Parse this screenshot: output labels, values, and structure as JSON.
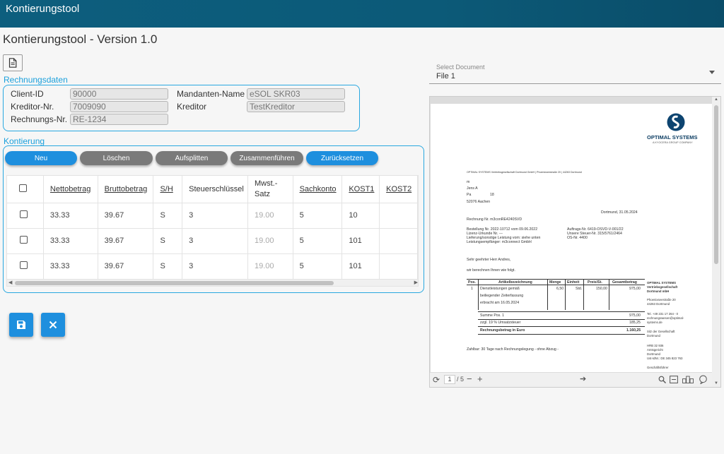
{
  "app": {
    "title": "Kontierungstool",
    "heading": "Kontierungstool - Version 1.0"
  },
  "rechnungsdaten": {
    "legend": "Rechnungsdaten",
    "client_id_label": "Client-ID",
    "client_id": "90000",
    "kreditor_nr_label": "Kreditor-Nr.",
    "kreditor_nr": "7009090",
    "rechnungs_nr_label": "Rechnungs-Nr.",
    "rechnungs_nr": "RE-1234",
    "mandant_label": "Mandanten-Name",
    "mandant": "eSOL SKR03",
    "kreditor_label": "Kreditor",
    "kreditor": "TestKreditor"
  },
  "kontierung": {
    "legend": "Kontierung",
    "buttons": {
      "neu": "Neu",
      "loeschen": "Löschen",
      "aufsplitten": "Aufsplitten",
      "zusammen": "Zusammenführen",
      "reset": "Zurücksetzen"
    },
    "columns": [
      "Nettobetrag",
      "Bruttobetrag",
      "S/H",
      "Steuerschlüssel",
      "Mwst.-Satz",
      "Sachkonto",
      "KOST1",
      "KOST2"
    ],
    "rows": [
      {
        "netto": "33.33",
        "brutto": "39.67",
        "sh": "S",
        "steuer": "3",
        "mwst": "19.00",
        "sachkonto": "5",
        "kost1": "10",
        "kost2": ""
      },
      {
        "netto": "33.33",
        "brutto": "39.67",
        "sh": "S",
        "steuer": "3",
        "mwst": "19.00",
        "sachkonto": "5",
        "kost1": "101",
        "kost2": ""
      },
      {
        "netto": "33.33",
        "brutto": "39.67",
        "sh": "S",
        "steuer": "3",
        "mwst": "19.00",
        "sachkonto": "5",
        "kost1": "101",
        "kost2": ""
      }
    ]
  },
  "actions": {
    "save_icon": "save-icon",
    "cancel_icon": "close-icon"
  },
  "document_select": {
    "label": "Select Document",
    "value": "File 1"
  },
  "viewer": {
    "page_current": "1",
    "page_total": "/ 5",
    "doc": {
      "brand": "OPTIMAL SYSTEMS",
      "brand_sub": "A KYOCERA GROUP COMPANY",
      "sender_line": "OPTIMAL SYSTEMS Vertriebsgesellschaft Dortmund GmbH | Phoenixseestraße 20 | 44263 Dortmund",
      "addr1": "m",
      "addr2": "Jens A",
      "addr3": "Pa",
      "addr3b": "18",
      "addr4": "52076 Aachen",
      "date": "Dortmund, 31.05.2024",
      "invoice_no": "Rechnung Nr. m3conRE4240SVD",
      "order1": "Bestellung Nr. 2022-10712 vom 09.06.2022",
      "order2": "Lizenz-Urkunde Nr. ---",
      "order3": "Lieferung/sonstige Leistung vom: siehe unten",
      "order4": "Leistungsempfänger: m3connect GmbH",
      "right1": "Auftrags-Nr. 6419-OSVD-V-001/22",
      "right2": "Unsere Steuer-Nr. 315/5761/2464",
      "right3": "OS-Nr.       4400",
      "greeting": "Sehr geehrter Herr Andres,",
      "intro": "wir berechnen Ihnen wie folgt.",
      "col_pos": "Pos.",
      "col_art": "Artikelbezeichnung",
      "col_menge": "Menge",
      "col_einheit": "Einheit",
      "col_preis": "Preis/St.",
      "col_gesamt": "Gesamtbetrag",
      "row_pos": "1",
      "row_art1": "Dienstleistungen gemäß",
      "row_art2": "beiliegender Zeiterfassung",
      "row_art3": "erbracht am 16.05.2024",
      "row_menge": "6,50",
      "row_einheit": "Std.",
      "row_preis": "150,00",
      "row_gesamt": "975,00",
      "sum1_label": "Summe Pos. 1",
      "sum1": "975,00",
      "tax_label": "zzgl. 19 % Umsatzsteuer",
      "tax": "185,25",
      "total_label": "Rechnungsbetrag in Euro",
      "total": "1.160,25",
      "payment": "Zahlbar: 30 Tage nach Rechnungslegung - ohne Abzug -",
      "side1": "OPTIMAL SYSTEMS",
      "side2": "Vertriebsgesellschaft",
      "side3": "Dortmund mbH",
      "side4": "Phoenixseestraße 20",
      "side5": "44263 Dortmund",
      "side6": "Tel. +49 231 17 264 - 0",
      "side7": "rechnungswesen@optimal-",
      "side8": "systems.de",
      "side9": "Sitz der Gesellschaft",
      "side10": "Dortmund",
      "side11": "HRB 32 936",
      "side12": "Amtsgericht",
      "side13": "Dortmund",
      "side14": "Ust-IdNr.: DE 345 823 763",
      "side15": "Geschäftsführer"
    }
  }
}
